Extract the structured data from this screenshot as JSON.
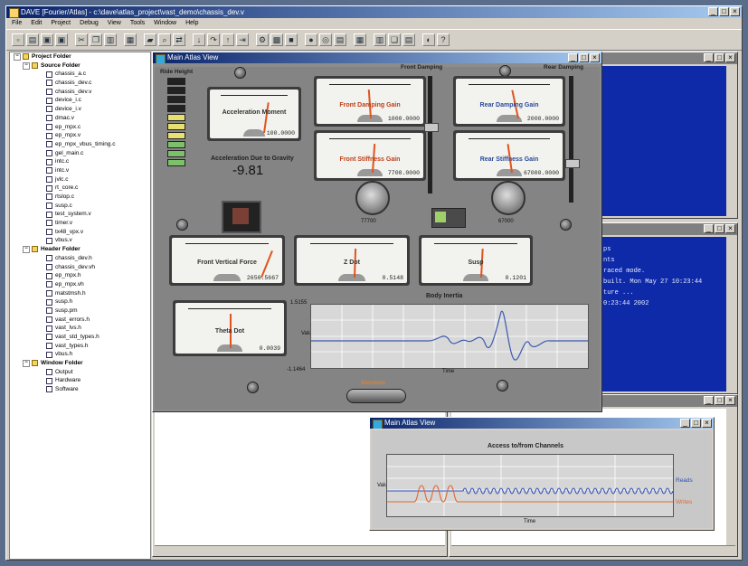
{
  "app": {
    "title": "DAVE [Fourier/Atlas] - c:\\dave\\atlas_project\\vast_demo\\chassis_dev.v",
    "menus": [
      "File",
      "Edit",
      "Project",
      "Debug",
      "View",
      "Tools",
      "Window",
      "Help"
    ]
  },
  "tree": {
    "folders": [
      {
        "name": "Project Folder",
        "level": 0,
        "items": []
      },
      {
        "name": "Source Folder",
        "level": 1,
        "items": [
          "chassis_a.c",
          "chassis_dev.c",
          "chassis_dev.v",
          "device_i.c",
          "device_i.v",
          "dmac.v",
          "ep_mpx.c",
          "ep_mpx.v",
          "ep_mpx_vbus_timing.c",
          "gel_main.c",
          "intc.c",
          "intc.v",
          "jvlc.c",
          "rt_core.c",
          "rtslop.c",
          "susp.c",
          "test_system.v",
          "timer.v",
          "tx48_vpx.v",
          "vbus.v"
        ]
      },
      {
        "name": "Header Folder",
        "level": 1,
        "items": [
          "chassis_dev.h",
          "chassis_dev.vh",
          "ep_mpx.h",
          "ep_mpx.vh",
          "matstmsh.h",
          "susp.h",
          "susp.pm",
          "vast_errors.h",
          "vast_lvs.h",
          "vast_std_types.h",
          "vast_types.h",
          "vbus.h"
        ]
      },
      {
        "name": "Window Folder",
        "level": 1,
        "items": [
          "Output",
          "Hardware",
          "Software"
        ]
      }
    ]
  },
  "atlas_window": {
    "title": "Main Atlas View",
    "ride_height_label": "Ride Height",
    "front_damping_label": "Front Damping",
    "rear_damping_label": "Rear Damping",
    "meters": {
      "acceleration_moment": {
        "label": "Acceleration Moment",
        "value": "100.0000"
      },
      "front_damping_gain": {
        "label": "Front Damping Gain",
        "value": "1000.0000"
      },
      "rear_damping_gain": {
        "label": "Rear Damping Gain",
        "value": "2000.0000"
      },
      "front_stiffness_gain": {
        "label": "Front Stiffness Gain",
        "value": "7700.0000"
      },
      "rear_stiffness_gain": {
        "label": "Rear Stiffness Gain",
        "value": "67000.0000"
      },
      "front_vertical_force": {
        "label": "Front Vertical Force",
        "value": "2656.5667"
      },
      "z_dot": {
        "label": "Z Dot",
        "value": "0.5148"
      },
      "susp": {
        "label": "Susp",
        "value": "0.1201"
      },
      "theta_dot": {
        "label": "Theta Dot",
        "value": "0.0039"
      }
    },
    "gravity_label": "Acceleration Due to Gravity",
    "gravity_value": "-9.81",
    "dial_left_value": "77700",
    "dial_right_value": "67000",
    "chart": {
      "title": "Body Inertia",
      "y_max": "1.5155",
      "y_min": "-1.1464",
      "xlabel": "Time",
      "ylabel": "Value"
    },
    "button_label": "Simulate"
  },
  "access_window": {
    "title": "Main Atlas View",
    "chart_title": "Access to/from Channels",
    "series": [
      "Reads",
      "Writes"
    ],
    "xlabel": "Time",
    "ylabel": "Value"
  },
  "console": {
    "lines": [
      "ps",
      "nts",
      "raced mode.",
      "built. Mon May 27 10:23:44",
      "ture ...",
      "0:23:44 2002"
    ]
  },
  "colors": {
    "needle": "#e0541e",
    "title_start": "#0a246a",
    "console_bg": "#0f2aa8"
  }
}
